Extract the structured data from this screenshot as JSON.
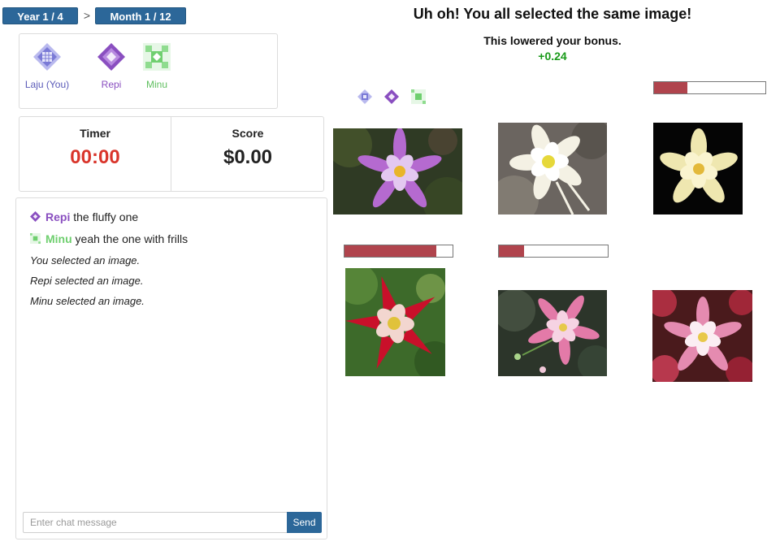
{
  "breadcrumb": {
    "year": "Year 1 / 4",
    "separator": ">",
    "month": "Month 1 / 12"
  },
  "players": [
    {
      "name": "Laju (You)",
      "icon": "grid-diamond-icon",
      "color": "#7a7ad6"
    },
    {
      "name": "Repi",
      "icon": "purple-diamond-icon",
      "color": "#8a4fc0"
    },
    {
      "name": "Minu",
      "icon": "green-square-icon",
      "color": "#6fcf6f"
    }
  ],
  "stats": {
    "timer_label": "Timer",
    "timer_value": "00:00",
    "score_label": "Score",
    "score_value": "$0.00"
  },
  "chat": {
    "messages": [
      {
        "sender": "Repi",
        "text": "the fluffy one",
        "color": "#8a4fc0"
      },
      {
        "sender": "Minu",
        "text": "yeah the one with frills",
        "color": "#6fcf6f"
      }
    ],
    "system": [
      "You selected an image.",
      "Repi selected an image.",
      "Minu selected an image."
    ],
    "input_placeholder": "Enter chat message",
    "send_label": "Send"
  },
  "result": {
    "headline": "Uh oh! You all selected the same image!",
    "subline": "This lowered your bonus.",
    "bonus": "+0.24"
  },
  "images": [
    {
      "id": "flower-1",
      "description": "purple columbine",
      "bar": 0.0
    },
    {
      "id": "flower-2",
      "description": "white columbine",
      "bar": null
    },
    {
      "id": "flower-3",
      "description": "pale yellow columbine",
      "bar": 0.3
    },
    {
      "id": "flower-4",
      "description": "red columbine",
      "bar": 0.85
    },
    {
      "id": "flower-5",
      "description": "pink columbine",
      "bar": 0.23
    },
    {
      "id": "flower-6",
      "description": "pink and white columbine",
      "bar": null
    }
  ],
  "colors": {
    "accent": "#2c6799",
    "timer": "#d9352b",
    "bonus": "#1a9a1a",
    "bar_fill": "#b0444d"
  }
}
